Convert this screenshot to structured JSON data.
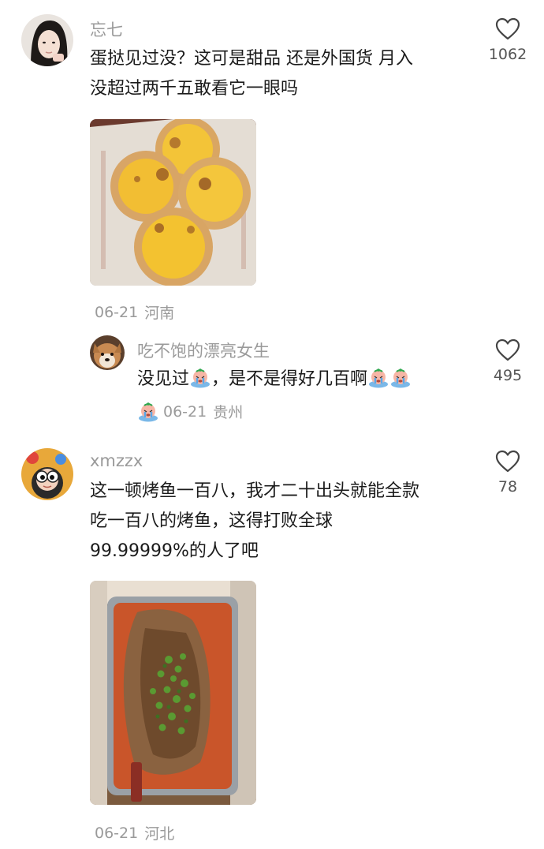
{
  "comments": [
    {
      "username": "忘七",
      "line1": "蛋挞见过没？这可是甜品 还是外国货 月入",
      "line2": "没超过两千五敢看它一眼吗",
      "date": "06-21",
      "location": "河南",
      "likes": "1062",
      "reply": {
        "username": "吃不饱的漂亮女生",
        "text_a": "没见过",
        "text_b": "，是不是得好几百啊",
        "date": "06-21",
        "location": "贵州",
        "likes": "495"
      }
    },
    {
      "username": "xmzzx",
      "line1": "这一顿烤鱼一百八，我才二十出头就能全款",
      "line2": "吃一百八的烤鱼，这得打败全球",
      "line3": "99.99999%的人了吧",
      "date": "06-21",
      "location": "河北",
      "likes": "78"
    }
  ],
  "colors": {
    "meta_gray": "#9a9a9a",
    "text": "#1b1b1b",
    "icon": "#444444"
  }
}
